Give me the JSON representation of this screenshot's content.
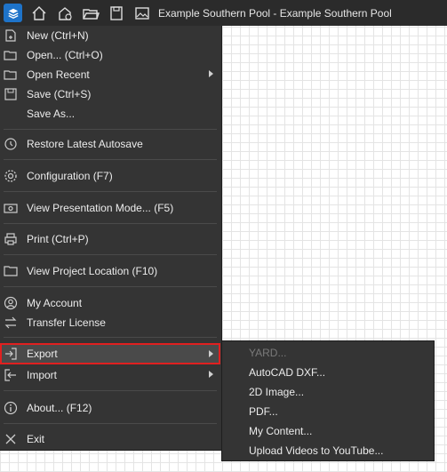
{
  "titlebar": {
    "title": "Example Southern Pool - Example Southern Pool"
  },
  "menu": {
    "items": [
      {
        "label": "New (Ctrl+N)"
      },
      {
        "label": "Open... (Ctrl+O)"
      },
      {
        "label": "Open Recent"
      },
      {
        "label": "Save (Ctrl+S)"
      },
      {
        "label": "Save As..."
      },
      {
        "label": "Restore Latest Autosave"
      },
      {
        "label": "Configuration (F7)"
      },
      {
        "label": "View Presentation Mode... (F5)"
      },
      {
        "label": "Print (Ctrl+P)"
      },
      {
        "label": "View Project Location (F10)"
      },
      {
        "label": "My Account"
      },
      {
        "label": "Transfer License"
      },
      {
        "label": "Export"
      },
      {
        "label": "Import"
      },
      {
        "label": "About... (F12)"
      },
      {
        "label": "Exit"
      }
    ]
  },
  "export_submenu": {
    "items": [
      {
        "label": "YARD...",
        "disabled": true
      },
      {
        "label": "AutoCAD DXF..."
      },
      {
        "label": "2D Image..."
      },
      {
        "label": "PDF..."
      },
      {
        "label": "My Content..."
      },
      {
        "label": "Upload Videos to YouTube..."
      }
    ]
  },
  "colors": {
    "menu_bg": "#343434",
    "highlight_outline": "#e02020",
    "accent": "#1e73c9"
  }
}
